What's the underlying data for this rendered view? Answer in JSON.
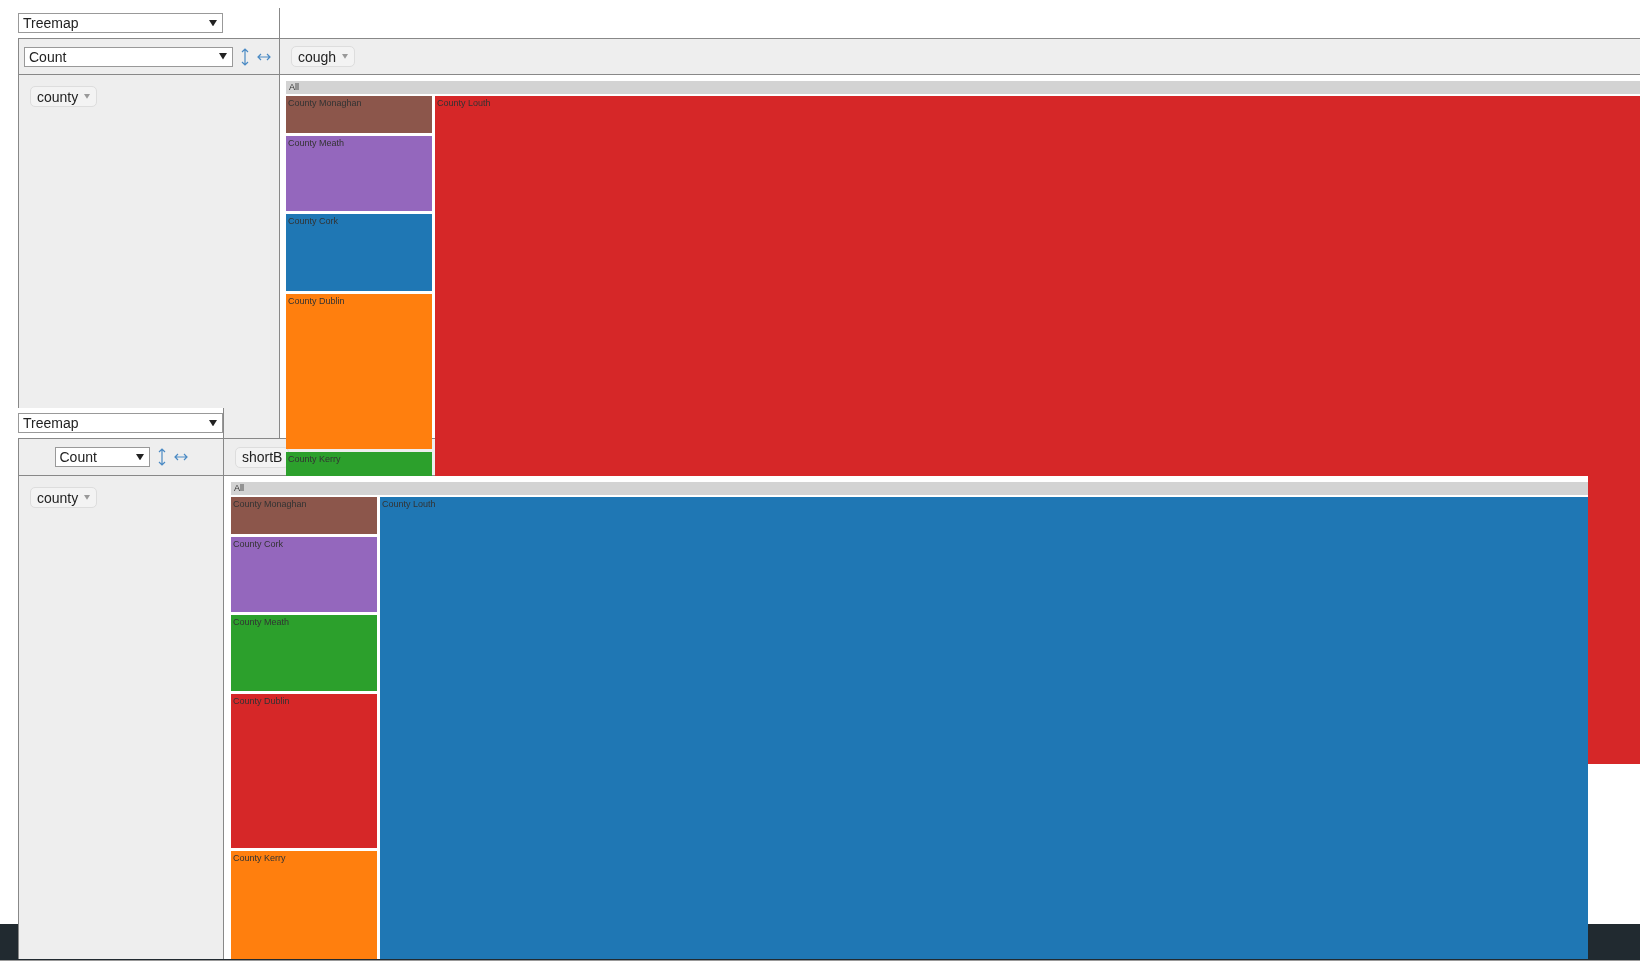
{
  "panels": [
    {
      "renderer": "Treemap",
      "aggregator": "Count",
      "column_fields": [
        {
          "label": "cough"
        }
      ],
      "row_fields": [
        {
          "label": "county"
        }
      ],
      "treemap": {
        "root": "All",
        "tiles": [
          {
            "label": "County Monaghan",
            "color": "#8c564b"
          },
          {
            "label": "County Meath",
            "color": "#9467bd"
          },
          {
            "label": "County Cork",
            "color": "#1f77b4"
          },
          {
            "label": "County Dublin",
            "color": "#ff7f0e"
          },
          {
            "label": "County Kerry",
            "color": "#2ca02c"
          },
          {
            "label": "County Louth",
            "color": "#d62728"
          }
        ]
      }
    },
    {
      "renderer": "Treemap",
      "aggregator": "Count",
      "column_fields": [
        {
          "label": "shortB"
        }
      ],
      "row_fields": [
        {
          "label": "county"
        }
      ],
      "treemap": {
        "root": "All",
        "tiles": [
          {
            "label": "County Monaghan",
            "color": "#8c564b"
          },
          {
            "label": "County Cork",
            "color": "#9467bd"
          },
          {
            "label": "County Meath",
            "color": "#2ca02c"
          },
          {
            "label": "County Dublin",
            "color": "#d62728"
          },
          {
            "label": "County Kerry",
            "color": "#ff7f0e"
          },
          {
            "label": "County Louth",
            "color": "#1f77b4"
          }
        ]
      }
    }
  ]
}
